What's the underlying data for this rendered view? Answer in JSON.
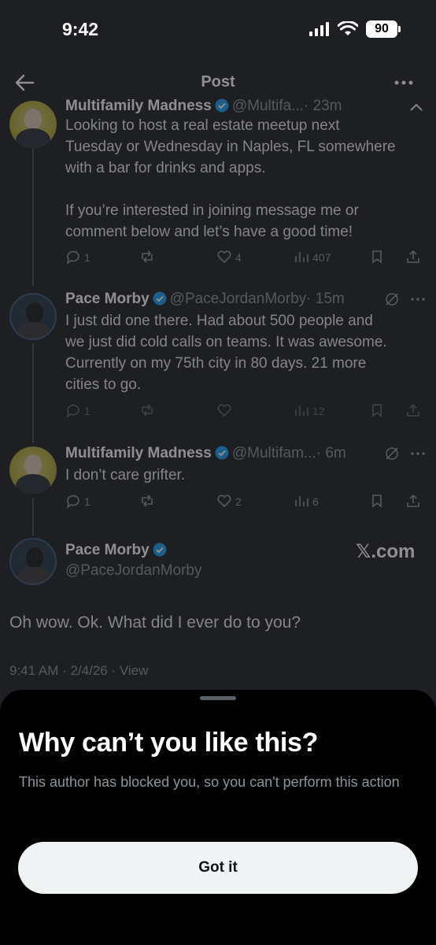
{
  "status_bar": {
    "time": "9:42",
    "battery": "90"
  },
  "header": {
    "title": "Post"
  },
  "posts": [
    {
      "name": "Multifamily Madness",
      "handle": "@Multifa...",
      "age": "· 23m",
      "text_lines": [
        "Looking to host a real estate meetup next",
        "Tuesday or Wednesday in Naples, FL somewhere",
        "with a bar for drinks and apps.",
        "",
        "If you’re interested in joining message me or",
        "comment below and let’s have a good time!"
      ],
      "replies": "1",
      "reposts": "",
      "likes": "4",
      "views": "407"
    },
    {
      "name": "Pace Morby",
      "handle": "@PaceJordanMorby",
      "age": "· 15m",
      "text_lines": [
        "I just did one there. Had about 500 people and",
        "we just did cold calls on teams. It was awesome.",
        "Currently on my 75th city in 80 days. 21 more",
        "cities to go."
      ],
      "replies": "1",
      "reposts": "",
      "likes": "",
      "views": "12"
    },
    {
      "name": "Multifamily Madness",
      "handle": "@Multifam...",
      "age": "· 6m",
      "text_lines": [
        "I don’t care grifter."
      ],
      "replies": "1",
      "reposts": "",
      "likes": "2",
      "views": "6"
    }
  ],
  "focused_post": {
    "name": "Pace Morby",
    "handle": "@PaceJordanMorby",
    "watermark": "𝕏.com",
    "text": "Oh wow. Ok. What did I ever do to you?",
    "meta": "9:41 AM · 2/4/26 · View"
  },
  "sheet": {
    "title": "Why can’t you like this?",
    "body": "This author has blocked you, so you can't perform this action",
    "button": "Got it"
  },
  "colors": {
    "accent": "#1d9bf0",
    "background": "#1e1f22",
    "sheet": "#000000",
    "button": "#eff3f4"
  }
}
